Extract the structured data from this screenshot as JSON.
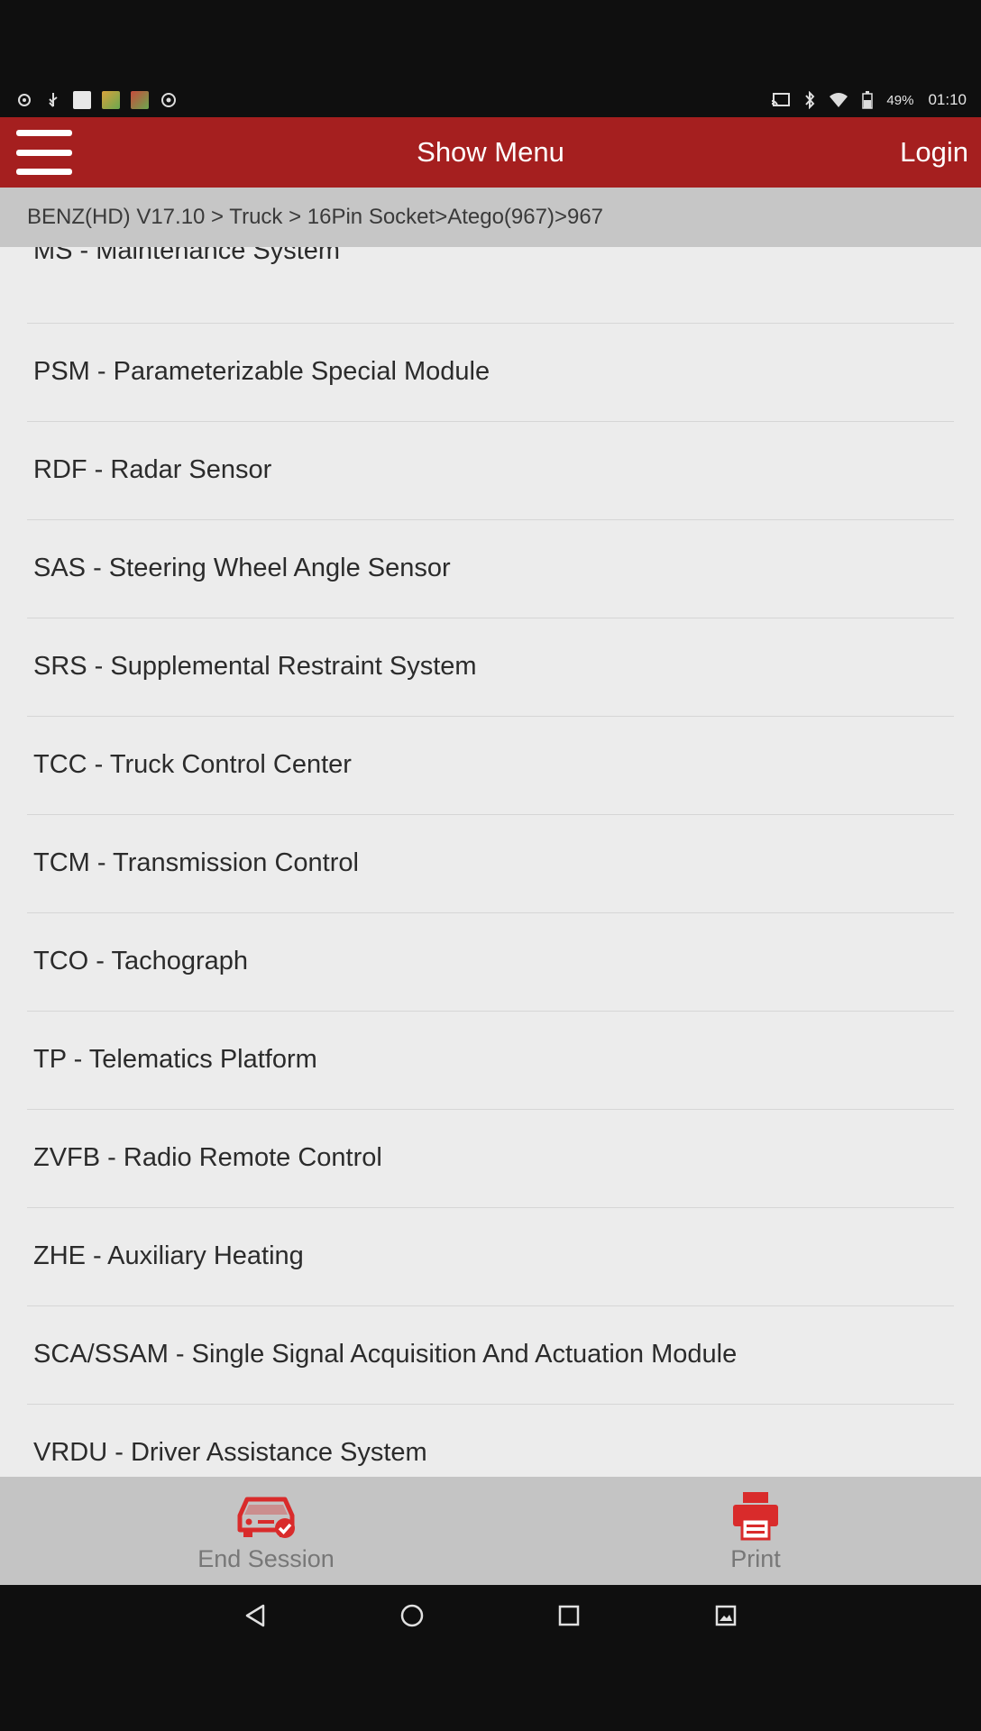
{
  "status_bar": {
    "battery": "49%",
    "time": "01:10",
    "left_icons": [
      "notification-icon",
      "usb-icon",
      "image-notification-icon",
      "app-notification-icon",
      "app-notification-icon",
      "settings-notification-icon"
    ],
    "right_icons": [
      "cast-icon",
      "bluetooth-icon",
      "wifi-icon",
      "battery-icon"
    ]
  },
  "header": {
    "title": "Show Menu",
    "login_label": "Login",
    "background": "#a51f1f"
  },
  "breadcrumb": "BENZ(HD) V17.10 > Truck > 16Pin Socket>Atego(967)>967",
  "systems": [
    "MS - Maintenance System",
    "PSM - Parameterizable Special Module",
    "RDF - Radar Sensor",
    "SAS - Steering Wheel Angle Sensor",
    "SRS - Supplemental Restraint System",
    "TCC - Truck Control Center",
    "TCM - Transmission Control",
    "TCO - Tachograph",
    "TP - Telematics Platform",
    "ZVFB - Radio Remote Control",
    "ZHE - Auxiliary Heating",
    "SCA/SSAM - Single Signal Acquisition And Actuation Module",
    "VRDU - Driver Assistance System"
  ],
  "toolbar": {
    "end_session_label": "End Session",
    "print_label": "Print",
    "icon_color": "#d92b2b"
  },
  "nav_bar": [
    "back-icon",
    "home-icon",
    "recents-icon",
    "screenshot-icon"
  ]
}
